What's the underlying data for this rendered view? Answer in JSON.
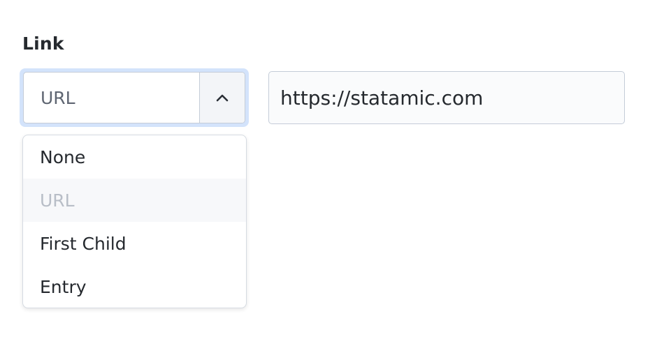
{
  "field": {
    "label": "Link"
  },
  "select": {
    "value": "URL",
    "toggle_icon": "chevron-up-icon",
    "options": [
      {
        "label": "None",
        "selected": false
      },
      {
        "label": "URL",
        "selected": true
      },
      {
        "label": "First Child",
        "selected": false
      },
      {
        "label": "Entry",
        "selected": false
      }
    ]
  },
  "url_input": {
    "value": "https://statamic.com"
  },
  "colors": {
    "focus_ring": "#d3e3fb",
    "border": "#c4ccd8",
    "selected_option_text": "#b8bec7"
  }
}
